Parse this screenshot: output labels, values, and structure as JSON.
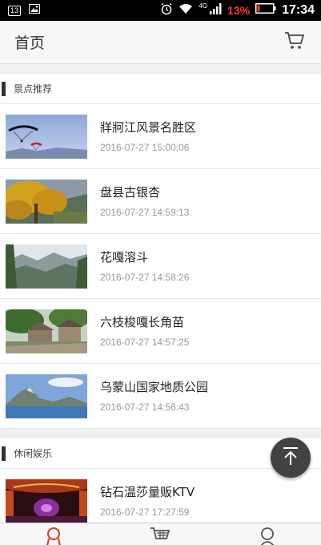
{
  "status_bar": {
    "notification_count": "13",
    "network": "4G",
    "battery_percent": "13%",
    "time": "17:34",
    "battery_color": "#ff3b30"
  },
  "header": {
    "title": "首页",
    "cart_icon": "cart-icon"
  },
  "sections": [
    {
      "title": "景点推荐",
      "items": [
        {
          "title": "牂牁江风景名胜区",
          "time": "2016-07-27 15:00:06",
          "image": "paragliding-sky"
        },
        {
          "title": "盘县古银杏",
          "time": "2016-07-27 14:59:13",
          "image": "ginkgo-tree"
        },
        {
          "title": "花嘎溶斗",
          "time": "2016-07-27 14:58:26",
          "image": "karst-valley"
        },
        {
          "title": "六枝梭嘎长角苗",
          "time": "2016-07-27 14:57:25",
          "image": "village-houses"
        },
        {
          "title": "乌蒙山国家地质公园",
          "time": "2016-07-27 14:56:43",
          "image": "mountain-lake"
        }
      ]
    },
    {
      "title": "休闲娱乐",
      "items": [
        {
          "title": "钻石温莎量贩KTV",
          "time": "2016-07-27 17:27:59",
          "image": "ktv-room"
        }
      ]
    }
  ],
  "back_to_top_icon": "arrow-up-icon",
  "bottom_nav": [
    {
      "icon": "home-icon",
      "active": true
    },
    {
      "icon": "cart-icon",
      "active": false
    },
    {
      "icon": "user-icon",
      "active": false
    }
  ],
  "colors": {
    "accent": "#d9342b",
    "header_bg": "#f7f7f7",
    "page_bg": "#f0f0f0"
  }
}
